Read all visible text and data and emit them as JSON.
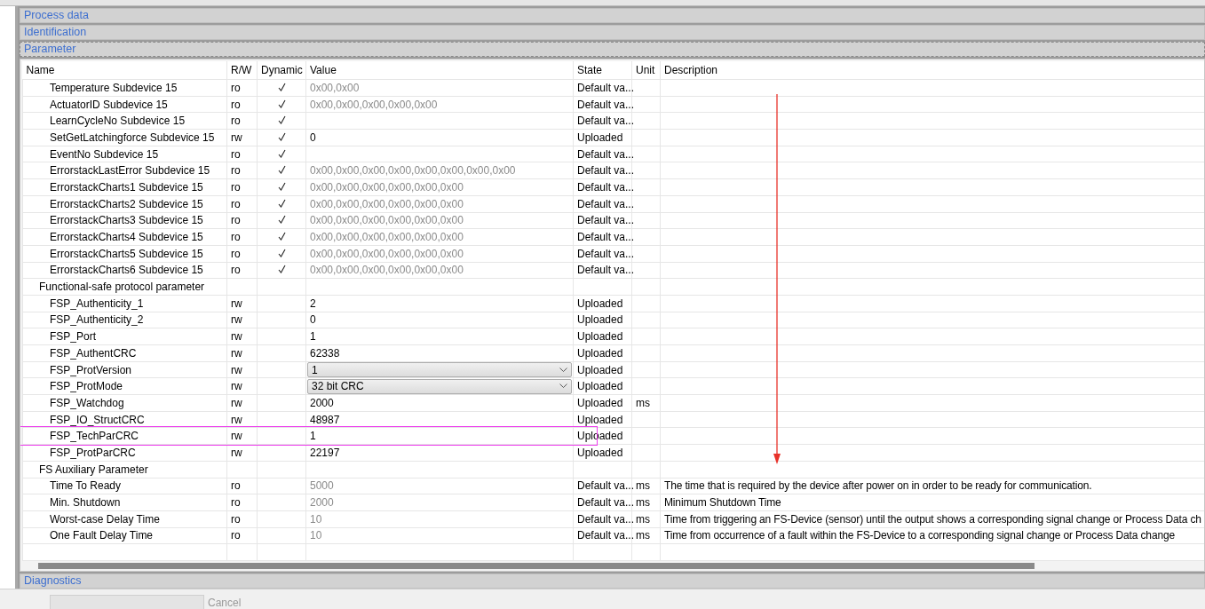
{
  "sections": [
    {
      "title": "Process data",
      "focused": false
    },
    {
      "title": "Identification",
      "focused": false
    },
    {
      "title": "Parameter",
      "focused": true
    }
  ],
  "table": {
    "columns": [
      "Name",
      "R/W",
      "Dynamic",
      "Value",
      "State",
      "Unit",
      "Description"
    ],
    "groups": [
      {
        "children": [
          {
            "name": "Temperature Subdevice 15",
            "access": "ro",
            "dynamic": true,
            "editable": false,
            "value": "0x00,0x00",
            "state": "Default va...",
            "highlighted": false
          },
          {
            "name": "ActuatorID Subdevice 15",
            "access": "ro",
            "dynamic": true,
            "editable": false,
            "value": "0x00,0x00,0x00,0x00,0x00",
            "state": "Default va...",
            "highlighted": false
          },
          {
            "name": "LearnCycleNo Subdevice 15",
            "access": "ro",
            "dynamic": true,
            "editable": false,
            "state": "Default va...",
            "highlighted": false
          },
          {
            "name": "SetGetLatchingforce Subdevice 15",
            "access": "rw",
            "dynamic": true,
            "editable": true,
            "value": "0",
            "state": "Uploaded",
            "highlighted": false
          },
          {
            "name": "EventNo Subdevice 15",
            "access": "ro",
            "dynamic": true,
            "editable": false,
            "state": "Default va...",
            "highlighted": false
          },
          {
            "name": "ErrorstackLastError Subdevice 15",
            "access": "ro",
            "dynamic": true,
            "editable": false,
            "value": "0x00,0x00,0x00,0x00,0x00,0x00,0x00,0x00",
            "state": "Default va...",
            "highlighted": false
          },
          {
            "name": "ErrorstackCharts1 Subdevice 15",
            "access": "ro",
            "dynamic": true,
            "editable": false,
            "value": "0x00,0x00,0x00,0x00,0x00,0x00",
            "state": "Default va...",
            "highlighted": false
          },
          {
            "name": "ErrorstackCharts2 Subdevice 15",
            "access": "ro",
            "dynamic": true,
            "editable": false,
            "value": "0x00,0x00,0x00,0x00,0x00,0x00",
            "state": "Default va...",
            "highlighted": false
          },
          {
            "name": "ErrorstackCharts3 Subdevice 15",
            "access": "ro",
            "dynamic": true,
            "editable": false,
            "value": "0x00,0x00,0x00,0x00,0x00,0x00",
            "state": "Default va...",
            "highlighted": false
          },
          {
            "name": "ErrorstackCharts4 Subdevice 15",
            "access": "ro",
            "dynamic": true,
            "editable": false,
            "value": "0x00,0x00,0x00,0x00,0x00,0x00",
            "state": "Default va...",
            "highlighted": false
          },
          {
            "name": "ErrorstackCharts5 Subdevice 15",
            "access": "ro",
            "dynamic": true,
            "editable": false,
            "value": "0x00,0x00,0x00,0x00,0x00,0x00",
            "state": "Default va...",
            "highlighted": false
          },
          {
            "name": "ErrorstackCharts6 Subdevice 15",
            "access": "ro",
            "dynamic": true,
            "editable": false,
            "value": "0x00,0x00,0x00,0x00,0x00,0x00",
            "state": "Default va...",
            "highlighted": false
          }
        ]
      },
      {
        "name": "Functional-safe protocol parameter",
        "children": [
          {
            "name": "FSP_Authenticity_1",
            "access": "rw",
            "dynamic": false,
            "editable": true,
            "value": "2",
            "state": "Uploaded",
            "highlighted": false
          },
          {
            "name": "FSP_Authenticity_2",
            "access": "rw",
            "dynamic": false,
            "editable": true,
            "value": "0",
            "state": "Uploaded",
            "highlighted": false
          },
          {
            "name": "FSP_Port",
            "access": "rw",
            "dynamic": false,
            "editable": true,
            "value": "1",
            "state": "Uploaded",
            "highlighted": false
          },
          {
            "name": "FSP_AuthentCRC",
            "access": "rw",
            "dynamic": false,
            "editable": true,
            "value": "62338",
            "state": "Uploaded",
            "highlighted": false
          },
          {
            "name": "FSP_ProtVersion",
            "access": "rw",
            "dynamic": false,
            "editable": true,
            "kind": "dropdown",
            "value": "1",
            "state": "Uploaded",
            "highlighted": false
          },
          {
            "name": "FSP_ProtMode",
            "access": "rw",
            "dynamic": false,
            "editable": true,
            "kind": "dropdown",
            "value": "32 bit CRC",
            "state": "Uploaded",
            "highlighted": false
          },
          {
            "name": "FSP_Watchdog",
            "access": "rw",
            "dynamic": false,
            "editable": true,
            "value": "2000",
            "state": "Uploaded",
            "unit": "ms",
            "highlighted": false
          },
          {
            "name": "FSP_IO_StructCRC",
            "access": "rw",
            "dynamic": false,
            "editable": true,
            "value": "48987",
            "state": "Uploaded",
            "highlighted": false
          },
          {
            "name": "FSP_TechParCRC",
            "access": "rw",
            "dynamic": false,
            "editable": true,
            "value": "1",
            "state": "Uploaded",
            "highlighted": true
          },
          {
            "name": "FSP_ProtParCRC",
            "access": "rw",
            "dynamic": false,
            "editable": true,
            "value": "22197",
            "state": "Uploaded",
            "highlighted": false
          }
        ]
      },
      {
        "name": "FS Auxiliary Parameter",
        "children": [
          {
            "name": "Time To Ready",
            "access": "ro",
            "dynamic": false,
            "editable": false,
            "value": "5000",
            "state": "Default va...",
            "unit": "ms",
            "description": "The time that is required by the device after power on in order to be ready for communication.",
            "highlighted": false
          },
          {
            "name": "Min. Shutdown",
            "access": "ro",
            "dynamic": false,
            "editable": false,
            "value": "2000",
            "state": "Default va...",
            "unit": "ms",
            "description": "Minimum Shutdown Time",
            "highlighted": false
          },
          {
            "name": "Worst-case Delay Time",
            "access": "ro",
            "dynamic": false,
            "editable": false,
            "value": "10",
            "state": "Default va...",
            "unit": "ms",
            "description": "Time from triggering an FS-Device (sensor) until the output shows a corresponding signal change or Process Data ch",
            "highlighted": false
          },
          {
            "name": "One Fault Delay Time",
            "access": "ro",
            "dynamic": false,
            "editable": false,
            "value": "10",
            "state": "Default va...",
            "unit": "ms",
            "description": "Time from occurrence of a fault within the FS-Device to a corresponding signal change or Process Data change",
            "highlighted": false
          }
        ]
      }
    ]
  },
  "footer_sections": [
    {
      "title": "Diagnostics",
      "focused": false
    }
  ],
  "buttons": [
    {
      "label": "Cancel",
      "disabled": true
    }
  ]
}
